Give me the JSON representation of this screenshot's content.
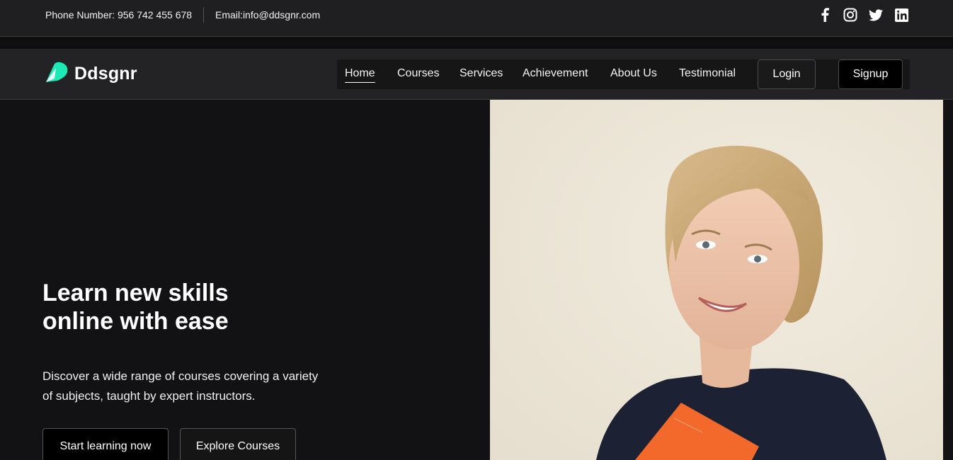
{
  "topbar": {
    "phone": "Phone Number: 956 742 455 678",
    "email": "Email:info@ddsgnr.com",
    "socials": [
      "facebook-icon",
      "instagram-icon",
      "twitter-icon",
      "linkedin-icon"
    ]
  },
  "brand": {
    "name": "Ddsgnr",
    "accent": "#1de9b6"
  },
  "nav": {
    "items": [
      "Home",
      "Courses",
      "Services",
      "Achievement",
      "About Us",
      "Testimonial"
    ],
    "active": "Home",
    "login": "Login",
    "signup": "Signup"
  },
  "hero": {
    "title_line1": "Learn new skills",
    "title_line2": "online with ease",
    "subtitle": "Discover a wide range of courses covering a variety of subjects, taught by expert instructors.",
    "cta_primary": "Start learning now",
    "cta_secondary": "Explore Courses"
  }
}
